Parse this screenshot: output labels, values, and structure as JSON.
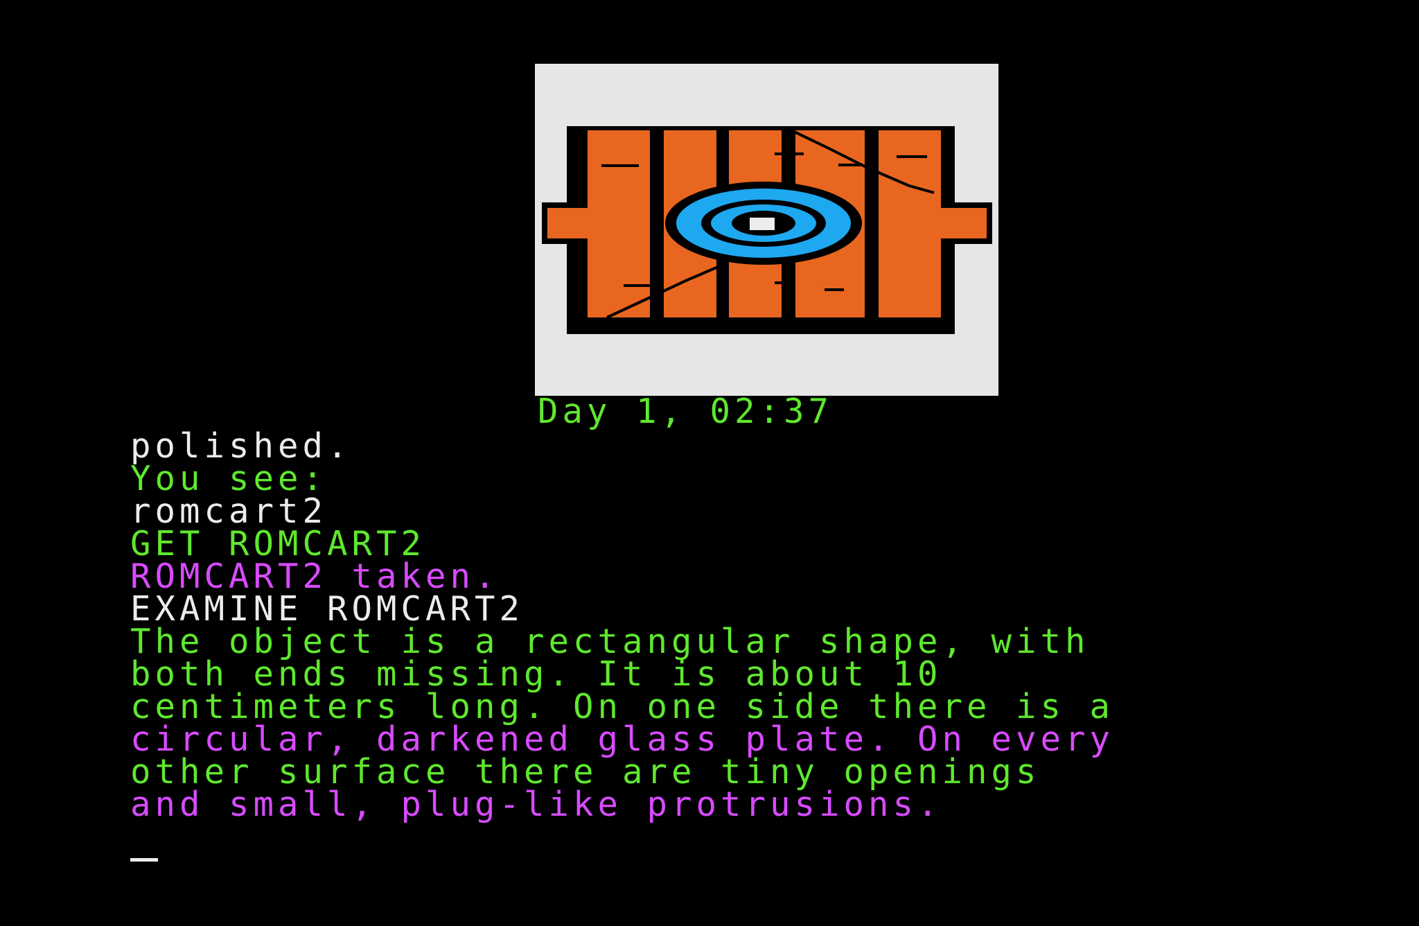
{
  "scene": {
    "icon": "rom-cartridge-illustration",
    "colors": {
      "frame": "#e6e6e6",
      "casing": "#e8661f",
      "lens": "#1ea8f0",
      "outline": "#000000"
    }
  },
  "status": {
    "text": "Day 1, 02:37"
  },
  "log": {
    "lines": [
      "polished.",
      "You see:",
      "romcart2",
      "GET ROMCART2",
      "ROMCART2 taken.",
      "EXAMINE ROMCART2",
      "The object is a rectangular shape, with",
      "both ends missing. It is about 10",
      "centimeters long. On one side there is a",
      "circular, darkened glass plate. On every",
      "other surface there are tiny openings",
      "and small, plug-like protrusions."
    ]
  },
  "prompt": {
    "cursor": "_"
  }
}
